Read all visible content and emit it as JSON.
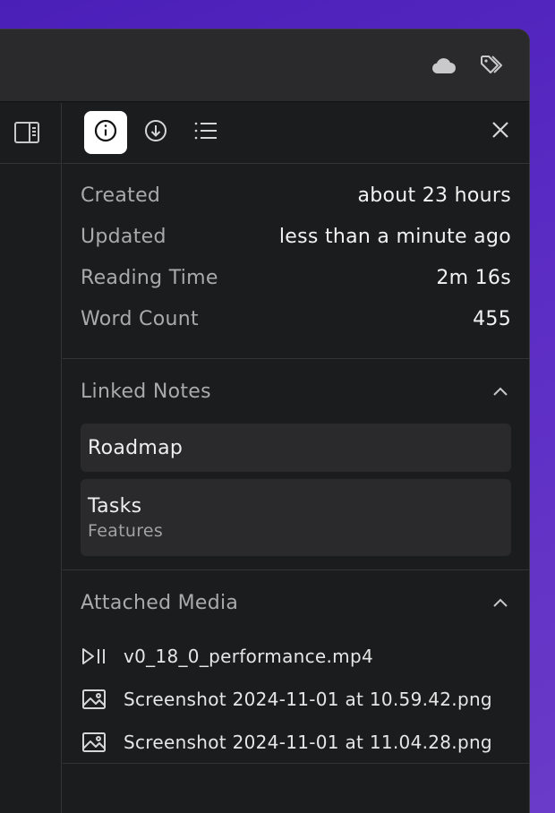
{
  "titlebar": {
    "cloud_icon": "cloud-icon",
    "tags_icon": "tags-icon"
  },
  "sidebar": {
    "toggle_icon": "sidebar-toggle-icon"
  },
  "toolbar": {
    "tabs": [
      {
        "icon": "info-icon",
        "active": true
      },
      {
        "icon": "download-icon",
        "active": false
      },
      {
        "icon": "list-icon",
        "active": false
      }
    ],
    "close_icon": "close-icon"
  },
  "metadata": [
    {
      "label": "Created",
      "value": "about 23 hours"
    },
    {
      "label": "Updated",
      "value": "less than a minute ago"
    },
    {
      "label": "Reading Time",
      "value": "2m 16s"
    },
    {
      "label": "Word Count",
      "value": "455"
    }
  ],
  "linked_notes": {
    "title": "Linked Notes",
    "items": [
      {
        "title": "Roadmap",
        "subtitle": ""
      },
      {
        "title": "Tasks",
        "subtitle": "Features"
      }
    ]
  },
  "attached_media": {
    "title": "Attached Media",
    "items": [
      {
        "icon": "play-pause-icon",
        "name": "v0_18_0_performance.mp4"
      },
      {
        "icon": "image-icon",
        "name": "Screenshot 2024-11-01 at 10.59.42.png"
      },
      {
        "icon": "image-icon",
        "name": "Screenshot 2024-11-01 at 11.04.28.png"
      }
    ]
  },
  "colors": {
    "background": "#1b1c1d",
    "titlebar": "#2a2a2c",
    "card": "#2a2a2c",
    "active_tab": "#ffffff",
    "text_primary": "#f2f2f2",
    "text_secondary": "#a9aaac"
  }
}
